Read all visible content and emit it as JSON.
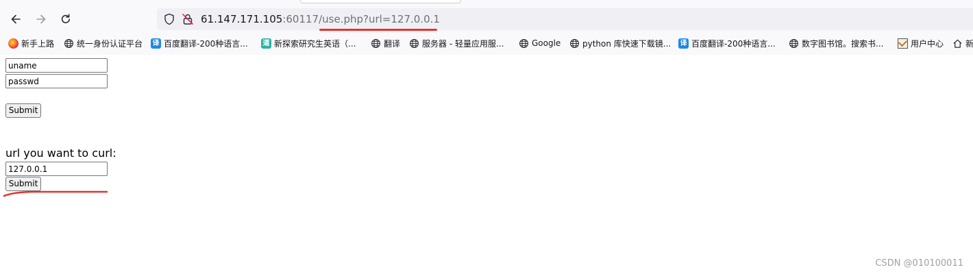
{
  "browser": {
    "url": {
      "host": "61.147.171.105",
      "rest": ":60117/use.php?url=127.0.0.1"
    },
    "icons": {
      "back": "back-arrow-icon",
      "forward": "forward-arrow-icon",
      "reload": "reload-icon",
      "shield": "shield-icon",
      "insecure": "insecure-lock-icon"
    }
  },
  "bookmarks": [
    {
      "label": "新手上路",
      "icon": "firefox-icon"
    },
    {
      "label": "统一身份认证平台",
      "icon": "globe-icon"
    },
    {
      "label": "百度翻译-200种语言...",
      "icon": "translate-icon"
    },
    {
      "label": "新探索研究生英语（...",
      "icon": "dao-icon"
    },
    {
      "label": "翻译",
      "icon": "globe-icon"
    },
    {
      "label": "服务器 - 轻量应用服...",
      "icon": "globe-icon"
    },
    {
      "label": "Google",
      "icon": "globe-icon"
    },
    {
      "label": "python 库快速下载镜...",
      "icon": "globe-icon"
    },
    {
      "label": "百度翻译-200种语言...",
      "icon": "translate-icon"
    },
    {
      "label": "数字图书馆。搜索书...",
      "icon": "globe-icon"
    },
    {
      "label": "用户中心",
      "icon": "user-center-icon"
    },
    {
      "label": "新",
      "icon": "home-icon"
    }
  ],
  "login_form": {
    "username_value": "uname",
    "password_value": "passwd",
    "submit_label": "Submit"
  },
  "curl_form": {
    "label": "url you want to curl:",
    "url_value": "127.0.0.1",
    "submit_label": "Submit"
  },
  "watermark": "CSDN @010100011",
  "colors": {
    "annotation_red": "#e8312f",
    "chrome_bg": "#f9f9fb",
    "urlbar_bg": "#f0f0f4"
  }
}
